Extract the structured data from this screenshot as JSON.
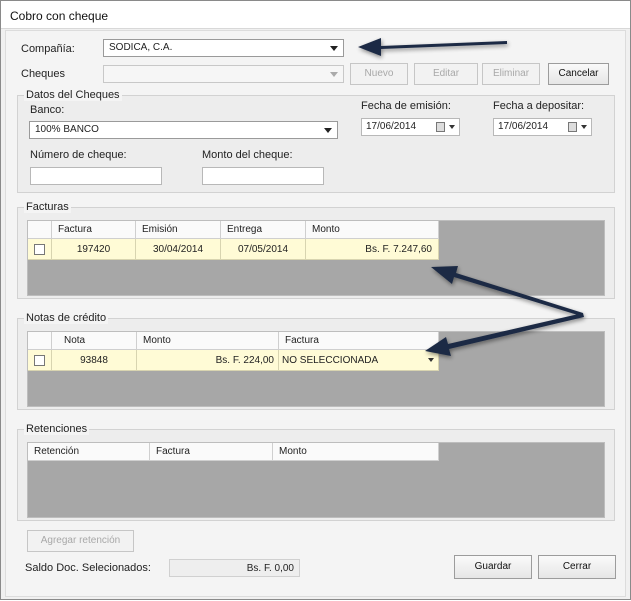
{
  "window": {
    "title": "Cobro con cheque"
  },
  "company": {
    "label": "Compañía:",
    "value": "SODICA, C.A."
  },
  "cheques": {
    "label": "Cheques",
    "value": ""
  },
  "buttons": {
    "nuevo": "Nuevo",
    "editar": "Editar",
    "eliminar": "Eliminar",
    "cancelar": "Cancelar",
    "agregar_retencion": "Agregar retención",
    "guardar": "Guardar",
    "cerrar": "Cerrar"
  },
  "datos_cheques": {
    "title": "Datos del Cheques",
    "banco_label": "Banco:",
    "banco_value": "100% BANCO",
    "fecha_emision_label": "Fecha de emisión:",
    "fecha_emision_value": "17/06/2014",
    "fecha_depositar_label": "Fecha a depositar:",
    "fecha_depositar_value": "17/06/2014",
    "numero_label": "Número de cheque:",
    "numero_value": "",
    "monto_label": "Monto del cheque:",
    "monto_value": ""
  },
  "facturas": {
    "title": "Facturas",
    "columns": [
      "Factura",
      "Emisión",
      "Entrega",
      "Monto"
    ],
    "rows": [
      {
        "checked": false,
        "factura": "197420",
        "emision": "30/04/2014",
        "entrega": "07/05/2014",
        "monto": "Bs. F. 7.247,60"
      }
    ]
  },
  "notas_credito": {
    "title": "Notas de crédito",
    "columns": [
      "Nota",
      "Monto",
      "Factura"
    ],
    "rows": [
      {
        "checked": false,
        "nota": "93848",
        "monto": "Bs. F. 224,00",
        "factura": "NO SELECCIONADA"
      }
    ]
  },
  "retenciones": {
    "title": "Retenciones",
    "columns": [
      "Retención",
      "Factura",
      "Monto"
    ]
  },
  "saldo": {
    "label": "Saldo Doc. Selecionados:",
    "value": "Bs. F. 0,00"
  },
  "colors": {
    "row_highlight": "#fffbd6",
    "grid_bg": "#a7a7a7",
    "annotation_arrow": "#1c2a44"
  }
}
